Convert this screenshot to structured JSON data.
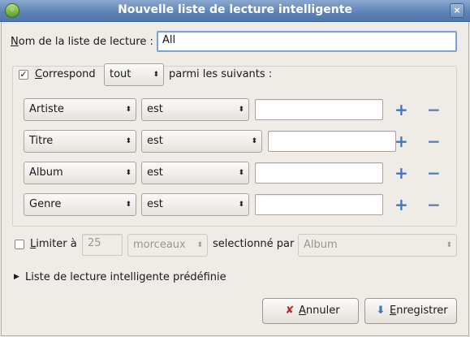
{
  "window": {
    "title": "Nouvelle liste de lecture intelligente"
  },
  "name_row": {
    "label_first": "N",
    "label_rest": "om de la liste de lecture :",
    "value": "All"
  },
  "match": {
    "checked": true,
    "label_first": "C",
    "label_rest": "orrespond",
    "combo_value": "tout",
    "suffix": "parmi les suivants :"
  },
  "rules": [
    {
      "field": "Artiste",
      "operator": "est",
      "value": ""
    },
    {
      "field": "Titre",
      "operator": "est",
      "value": ""
    },
    {
      "field": "Album",
      "operator": "est",
      "value": ""
    },
    {
      "field": "Genre",
      "operator": "est",
      "value": ""
    }
  ],
  "rule_buttons": {
    "add": "+",
    "remove": "−"
  },
  "limit": {
    "checked": false,
    "label_first": "L",
    "label_rest": "imiter à",
    "amount": "25",
    "unit": "morceaux",
    "selected_by_label": "selectionné par",
    "selected_by": "Album"
  },
  "predefined": {
    "label": "Liste de lecture intelligente prédéfinie"
  },
  "buttons": {
    "cancel_first": "A",
    "cancel_rest": "nnuler",
    "save_first": "E",
    "save_rest": "nregistrer"
  },
  "icons": {
    "cancel": "cross-icon",
    "save": "save-icon",
    "expander": "triangle-right-icon"
  },
  "colors": {
    "titlebar": "#5d82b6",
    "accent": "#3f77c1",
    "cancel_icon": "#c0262b"
  }
}
